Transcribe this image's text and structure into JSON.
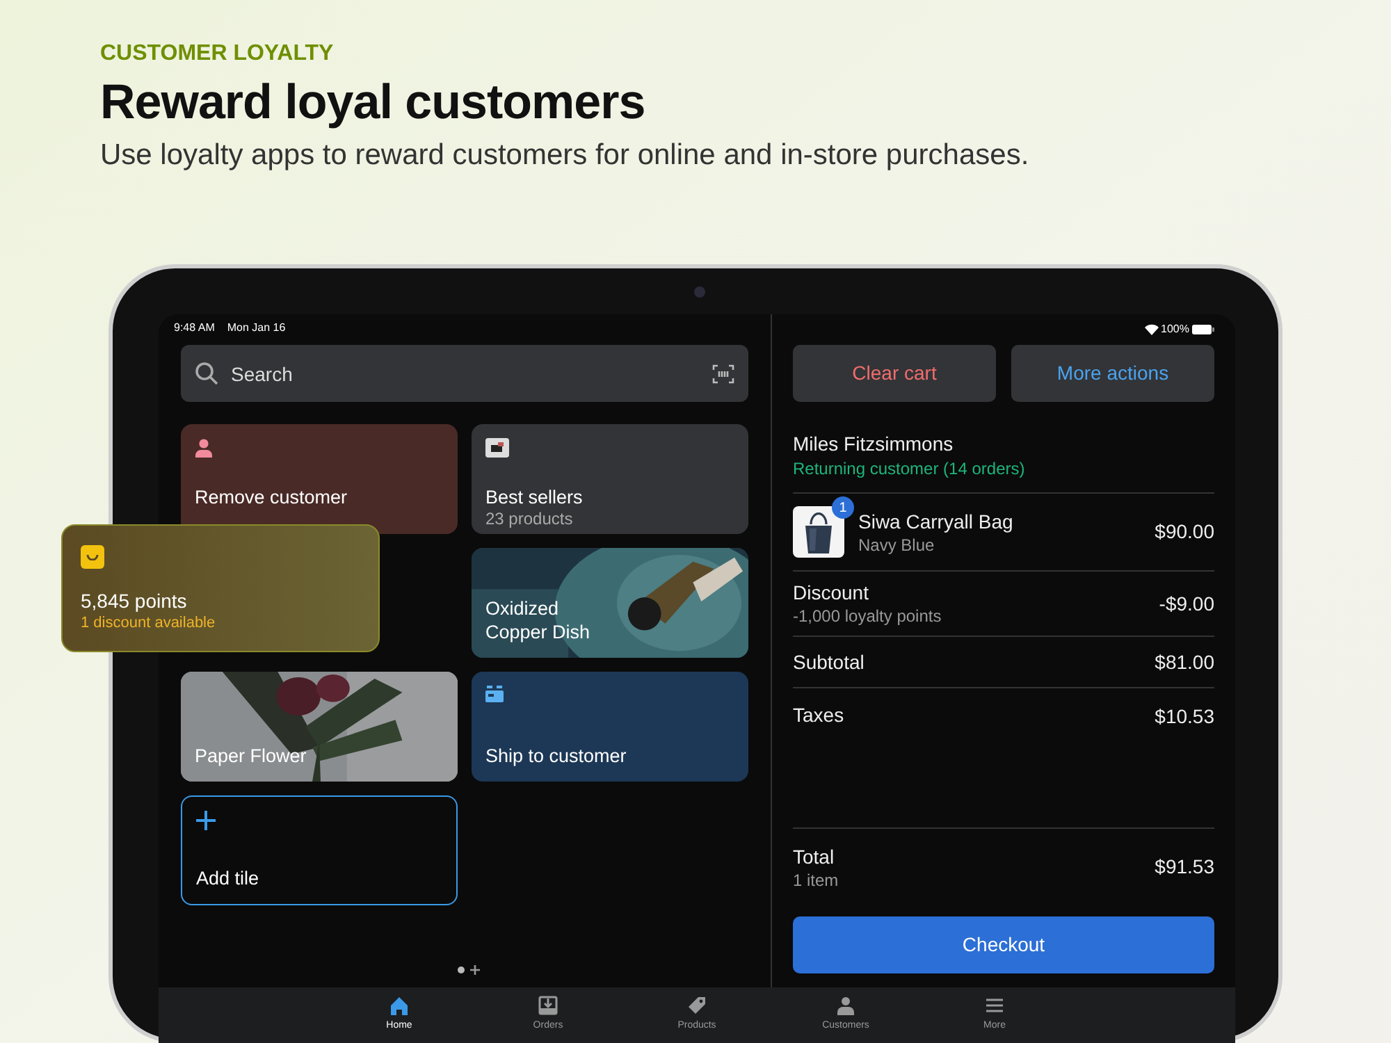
{
  "header": {
    "eyebrow": "CUSTOMER LOYALTY",
    "title": "Reward loyal customers",
    "subtitle": "Use loyalty apps to reward customers for online and in-store purchases."
  },
  "status_bar": {
    "time": "9:48 AM",
    "date": "Mon Jan 16",
    "battery": "100%"
  },
  "search": {
    "placeholder": "Search"
  },
  "tiles": [
    {
      "kind": "customer",
      "title": "Remove customer"
    },
    {
      "kind": "collection",
      "title": "Best sellers",
      "subtitle": "23 products"
    },
    {
      "kind": "product",
      "title": "Oxidized Copper Dish"
    },
    {
      "kind": "flower",
      "title": "Paper Flower"
    },
    {
      "kind": "shipping",
      "title": "Ship to customer"
    },
    {
      "kind": "add",
      "title": "Add tile"
    }
  ],
  "page_dots": [
    {
      "selected": true
    }
  ],
  "loyalty_card": {
    "points": "5,845 points",
    "discounts": "1 discount available"
  },
  "cart": {
    "actions": [
      {
        "label": "Clear cart",
        "kind": "danger"
      },
      {
        "label": "More actions",
        "kind": "primary"
      }
    ],
    "customer": {
      "name": "Miles Fitzsimmons",
      "note": "Returning customer (14 orders)"
    },
    "item": {
      "name": "Siwa Carryall Bag",
      "variant": "Navy Blue",
      "quantity": "1",
      "price": "$90.00"
    },
    "lines": [
      {
        "label": "Discount",
        "detail": "-1,000 loyalty points",
        "amount": "-$9.00"
      },
      {
        "label": "Subtotal",
        "amount": "$81.00"
      },
      {
        "label": "Taxes",
        "amount": "$10.53"
      }
    ],
    "total": {
      "label": "Total",
      "detail": "1 item",
      "amount": "$91.53"
    },
    "checkout": "Checkout"
  },
  "tabs": [
    {
      "label": "Home",
      "selected": true
    },
    {
      "label": "Orders",
      "selected": false
    },
    {
      "label": "Products",
      "selected": false
    },
    {
      "label": "Customers",
      "selected": false
    },
    {
      "label": "More",
      "selected": false
    }
  ]
}
